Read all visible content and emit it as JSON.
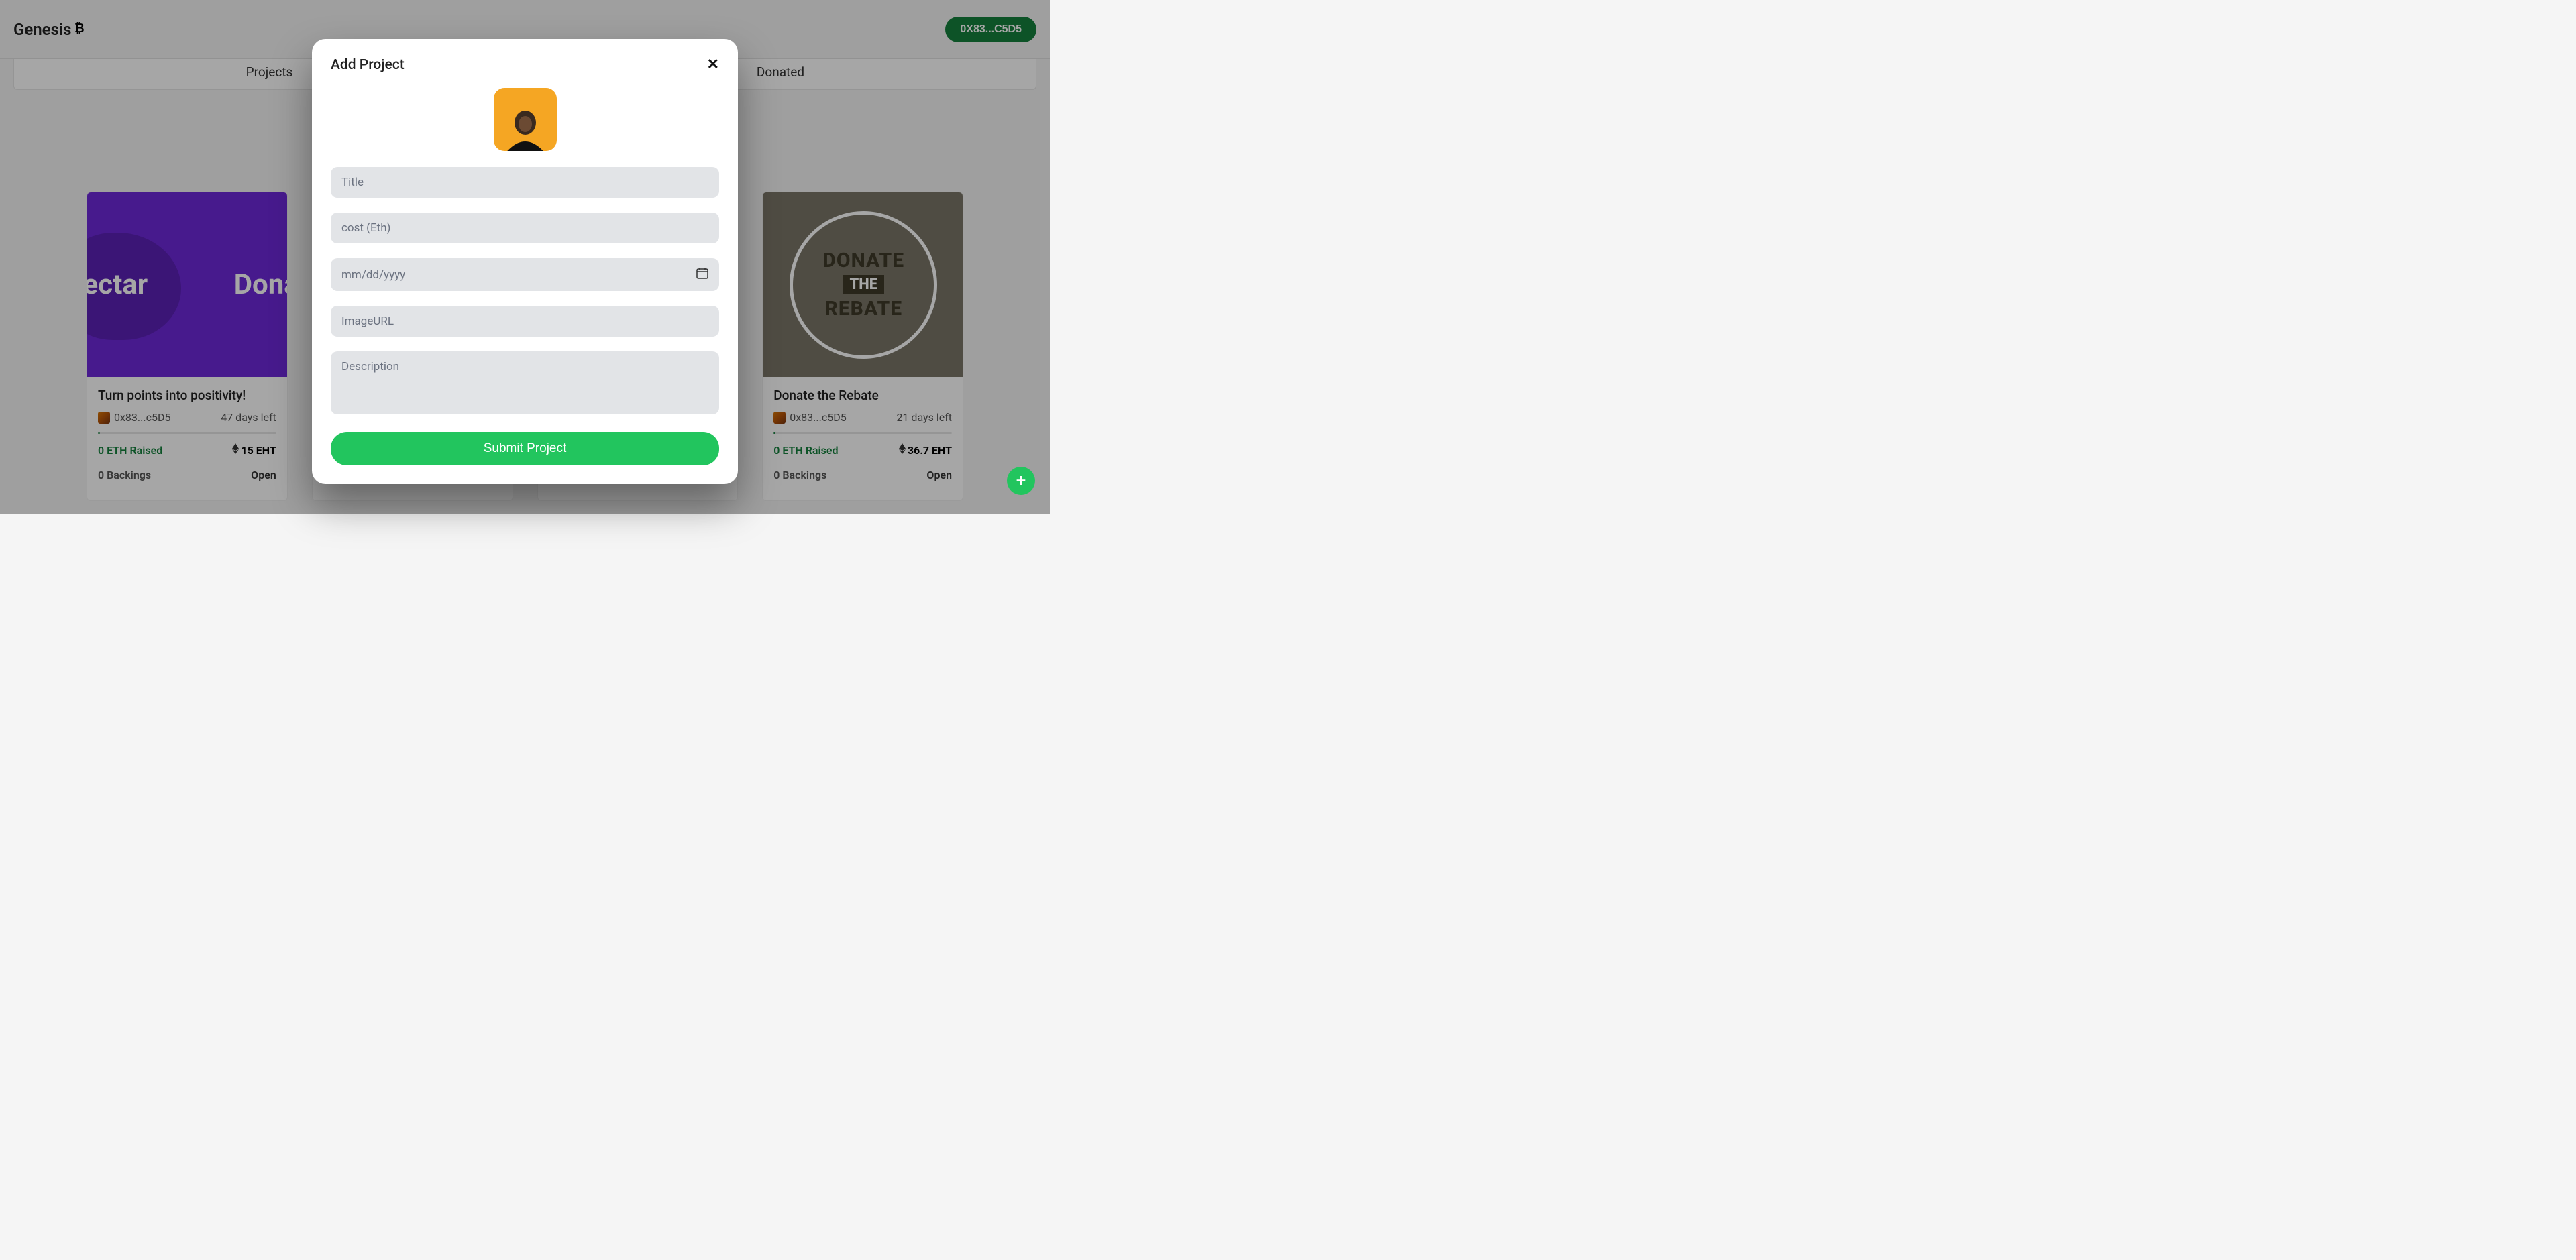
{
  "header": {
    "brand": "Genesis",
    "wallet": "0X83...C5D5"
  },
  "tabs": {
    "projects": "Projects",
    "donated": "Donated"
  },
  "cards": [
    {
      "title": "Turn points into positivity!",
      "owner": "0x83...c5D5",
      "days": "47 days left",
      "raised": "0 ETH Raised",
      "target": "15 EHT",
      "backings": "0 Backings",
      "status": "Open",
      "img_text1": "nectar",
      "img_text2": "Donat"
    },
    {
      "title": "",
      "owner": "",
      "days": "",
      "raised": "",
      "target": "",
      "backings": "",
      "status": ""
    },
    {
      "title": "",
      "owner": "",
      "days": "",
      "raised": "",
      "target": "",
      "backings": "",
      "status": ""
    },
    {
      "title": "Donate the Rebate",
      "owner": "0x83...c5D5",
      "days": "21 days left",
      "raised": "0 ETH Raised",
      "target": "36.7 EHT",
      "backings": "0 Backings",
      "status": "Open",
      "img_l1": "DONATE",
      "img_l2": "THE",
      "img_l3": "REBATE"
    }
  ],
  "modal": {
    "title": "Add Project",
    "placeholders": {
      "title": "Title",
      "cost": "cost (Eth)",
      "date": "mm/dd/yyyy",
      "image": "ImageURL",
      "description": "Description"
    },
    "submit": "Submit Project"
  }
}
